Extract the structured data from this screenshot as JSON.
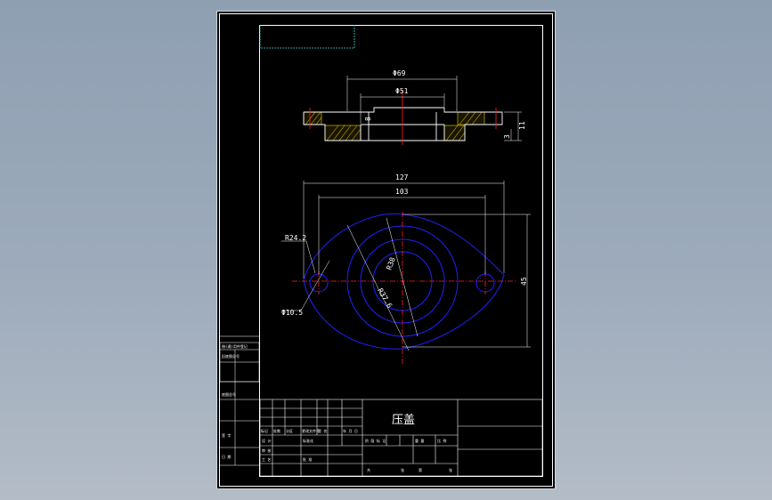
{
  "colors": {
    "background": "#000000",
    "outline": "#ffffff",
    "hatch": "#c8b400",
    "centerline": "#ff2020",
    "profile": "#2020ff",
    "frame_accent": "#40d0d0"
  },
  "drawing": {
    "part_title": "压盖",
    "section_view": {
      "dims": {
        "outer_diameter": "Φ69",
        "inner_diameter": "Φ51",
        "bore": "8",
        "height_total": "11",
        "height_flange": "3"
      }
    },
    "plan_view": {
      "dims": {
        "overall_length": "127",
        "hole_spacing": "103",
        "height": "45",
        "lobe_radius": "R24.2",
        "hole_diameter": "Φ10.5",
        "ring_radius_1": "R38",
        "ring_radius_2": "R37.6"
      }
    }
  },
  "title_block": {
    "left_column": [
      "借(通)用件登记",
      "旧底图总号",
      "底图总号",
      "签 字",
      "日 期"
    ],
    "row_labels": [
      "标记",
      "处数",
      "分区",
      "更改文件号",
      "签 名",
      "年 月 日"
    ],
    "sign_labels": [
      "设 计",
      "审 核",
      "工 艺",
      "标准化",
      "批 准"
    ],
    "stage_header": [
      "阶 段 标 记",
      "重 量",
      "比 例"
    ],
    "sheet_info": [
      "共",
      "张",
      "第",
      "张"
    ]
  }
}
